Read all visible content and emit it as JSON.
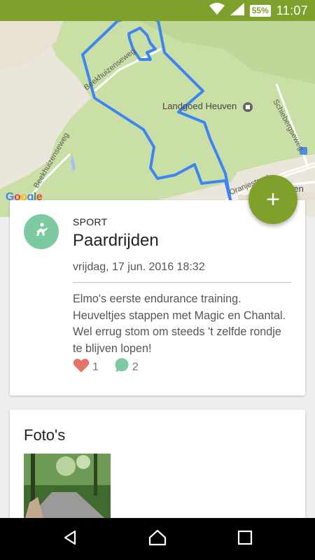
{
  "status_bar": {
    "battery": "55%",
    "time": "11:07"
  },
  "map": {
    "labels": {
      "landgoed": "Landgoed Heuven",
      "beekhuizen": "Beekhuizenseweg",
      "beekhuizenseweg": "Beekhuizenseweg",
      "schiebergseweg": "Schiebergseweg",
      "oranje": "Oranjestraat",
      "den": "Den"
    },
    "attribution": [
      "G",
      "o",
      "o",
      "g",
      "l",
      "e"
    ],
    "route_color": "#3d85f5"
  },
  "fab": {
    "label": "+"
  },
  "activity": {
    "category": "SPORT",
    "title": "Paardrijden",
    "date": "vrijdag, 17 jun. 2016 18:32",
    "description": "Elmo's eerste endurance training. Heuveltjes stappen met Magic en Chantal. Wel errug stom om steeds 't zelfde rondje te blijven lopen!",
    "likes": "1",
    "comments": "2",
    "avatar_color": "#7dc9a1",
    "like_color": "#e57368",
    "comment_color": "#7dc9a1"
  },
  "photos": {
    "heading": "Foto's"
  },
  "colors": {
    "accent": "#7fa12b"
  }
}
